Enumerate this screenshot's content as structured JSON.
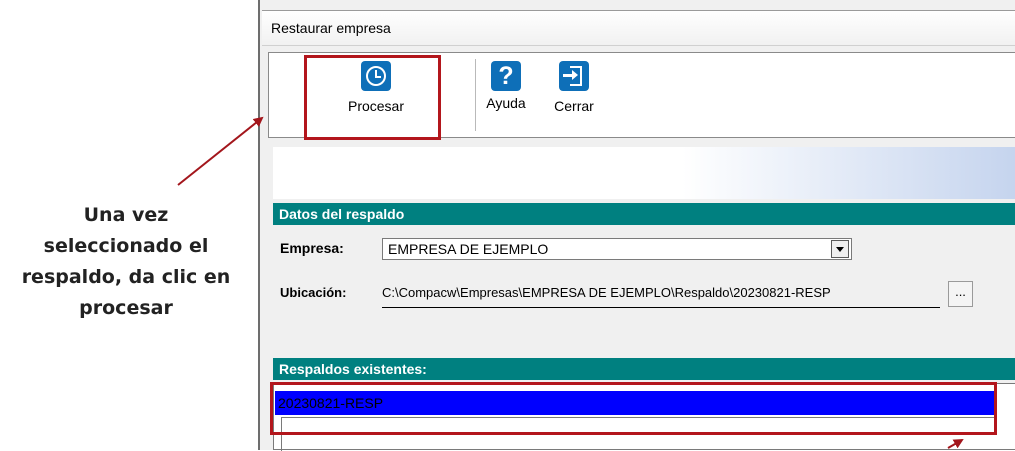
{
  "annotation": {
    "lines": [
      "Una vez",
      "seleccionado el",
      "respaldo, da clic en",
      "procesar"
    ]
  },
  "window": {
    "title": "Restaurar empresa"
  },
  "toolbar": {
    "buttons": [
      {
        "label": "Procesar",
        "icon": "clock-icon"
      },
      {
        "label": "Ayuda",
        "icon": "help-icon"
      },
      {
        "label": "Cerrar",
        "icon": "exit-door-icon"
      }
    ]
  },
  "datos_respaldo": {
    "header": "Datos del respaldo",
    "empresa_label": "Empresa:",
    "empresa_value": "EMPRESA DE EJEMPLO",
    "ubicacion_label": "Ubicación:",
    "ubicacion_value": "C:\\Compacw\\Empresas\\EMPRESA DE EJEMPLO\\Respaldo\\20230821-RESP",
    "browse_label": "..."
  },
  "respaldos": {
    "header": "Respaldos existentes:",
    "items": [
      "20230821-RESP"
    ]
  },
  "colors": {
    "accent_teal": "#008080",
    "highlight_red": "#b3161c",
    "selection_blue": "#0000ff",
    "icon_blue": "#0e6fb8"
  }
}
